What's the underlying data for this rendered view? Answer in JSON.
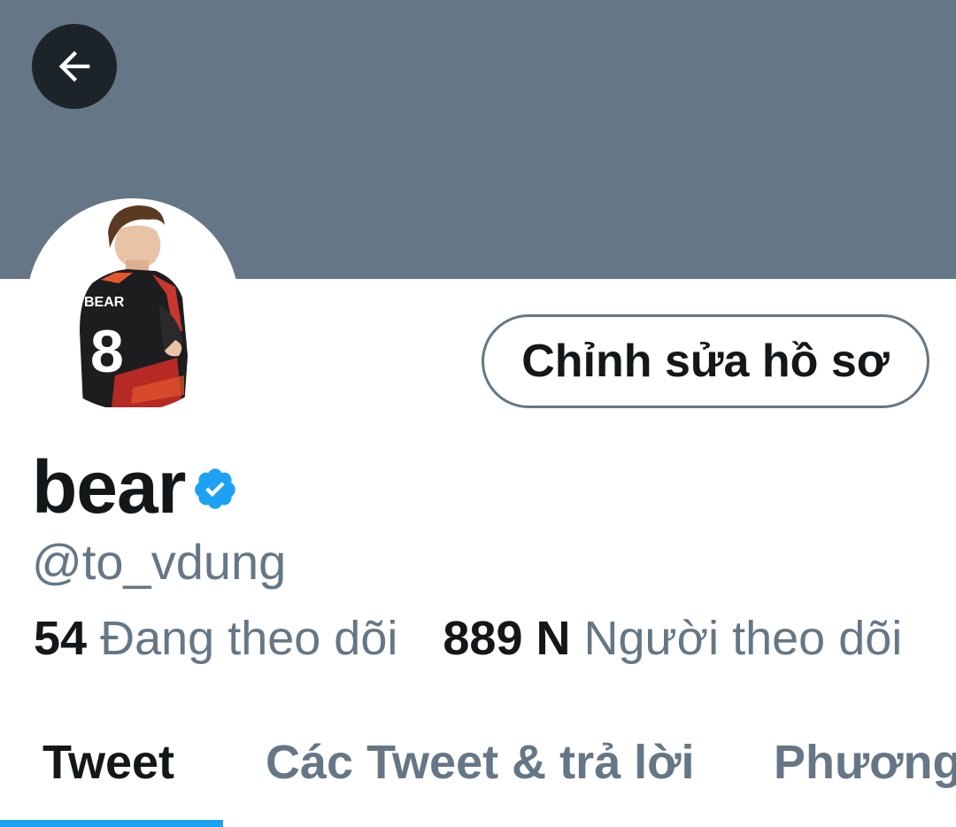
{
  "profile": {
    "display_name": "bear",
    "handle": "@to_vdung",
    "verified": true,
    "edit_button_label": "Chỉnh sửa hồ sơ",
    "avatar_jersey_text": "BEAR",
    "avatar_jersey_number": "8"
  },
  "stats": {
    "following_count": "54",
    "following_label": "Đang theo dõi",
    "followers_count": "889 N",
    "followers_label": "Người theo dõi"
  },
  "tabs": [
    {
      "label": "Tweet",
      "active": true
    },
    {
      "label": "Các Tweet & trả lời",
      "active": false
    },
    {
      "label": "Phương",
      "active": false
    }
  ],
  "icons": {
    "back": "arrow-left-icon",
    "verified": "verified-badge-icon"
  },
  "colors": {
    "banner": "#657786",
    "accent": "#1da1f2",
    "text_primary": "#14171a",
    "text_secondary": "#657786"
  }
}
